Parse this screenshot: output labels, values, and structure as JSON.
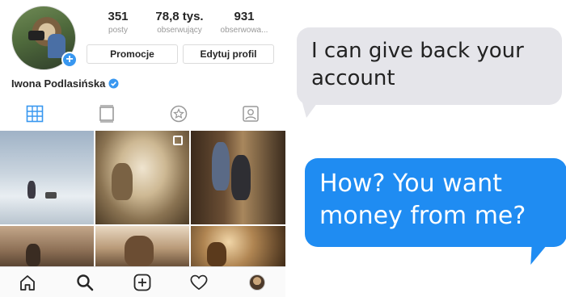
{
  "profile": {
    "stats": [
      {
        "value": "351",
        "label": "posty"
      },
      {
        "value": "78,8 tys.",
        "label": "obserwujący"
      },
      {
        "value": "931",
        "label": "obserwowa..."
      }
    ],
    "buttons": {
      "promote": "Promocje",
      "edit_profile": "Edytuj profil"
    },
    "username": "Iwona Podlasińska"
  },
  "tabs": [
    {
      "icon": "grid-icon",
      "active": true
    },
    {
      "icon": "feed-icon",
      "active": false
    },
    {
      "icon": "star-icon",
      "active": false
    },
    {
      "icon": "tagged-user-icon",
      "active": false
    }
  ],
  "bottom_nav": [
    "home-icon",
    "search-icon",
    "add-post-icon",
    "heart-icon",
    "profile-avatar"
  ],
  "chat": {
    "received": "I can give back your account",
    "sent": "How? You want money from me?"
  },
  "colors": {
    "accent_blue": "#1f8cf2",
    "ig_blue": "#3897f0",
    "bubble_gray": "#e5e5ea"
  }
}
